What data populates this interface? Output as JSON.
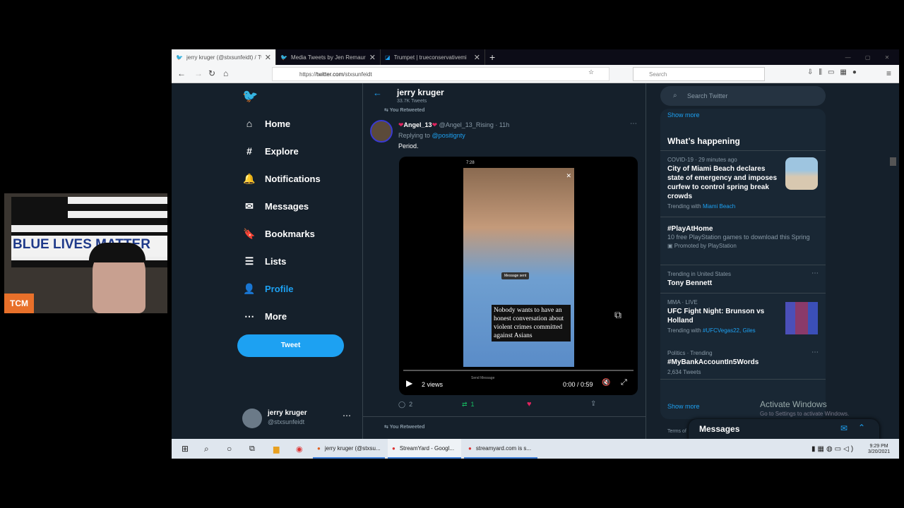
{
  "browser": {
    "tabs": [
      {
        "title": "jerry kruger (@stxsunfeidt) / Tw",
        "active": true
      },
      {
        "title": "Media Tweets by Jen Remauro",
        "active": false
      },
      {
        "title": "Trumpet | trueconservativemi",
        "active": false
      }
    ],
    "url_prefix": "https://",
    "url_domain": "twitter.com",
    "url_path": "/stxsunfeidt",
    "search_placeholder": "Search"
  },
  "nav": {
    "items": [
      {
        "label": "Home",
        "icon": "⌂"
      },
      {
        "label": "Explore",
        "icon": "#"
      },
      {
        "label": "Notifications",
        "icon": "🔔"
      },
      {
        "label": "Messages",
        "icon": "✉"
      },
      {
        "label": "Bookmarks",
        "icon": "🔖"
      },
      {
        "label": "Lists",
        "icon": "☰"
      },
      {
        "label": "Profile",
        "icon": "👤",
        "active": true
      },
      {
        "label": "More",
        "icon": "⋯"
      }
    ],
    "tweet_button": "Tweet",
    "user_name": "jerry kruger",
    "user_handle": "@stxsunfeidt"
  },
  "header": {
    "title": "jerry kruger",
    "tweet_count": "33.7K Tweets"
  },
  "tweet": {
    "retweeted_label": "You Retweeted",
    "name": "Angel_13",
    "handle": "@Angel_13_Rising",
    "time": "11h",
    "replying_prefix": "Replying to",
    "replying_to": "@positignty",
    "text": "Period.",
    "video": {
      "clock": "7:28",
      "overlay_text": "Nobody wants to have an honest conversation about violent crimes committed against Asians",
      "message_sent": "Message sent",
      "send_message": "Send Message",
      "views": "2 views",
      "time": "0:00 / 0:59"
    },
    "replies": "2",
    "retweets": "1"
  },
  "next_retweet_label": "You Retweeted",
  "right": {
    "search_placeholder": "Search Twitter",
    "show_more_top": "Show more",
    "section_title": "What’s happening",
    "trends": [
      {
        "cat": "COVID-19 · 29 minutes ago",
        "title": "City of Miami Beach declares state of emergency and imposes curfew to control spring break crowds",
        "sub_prefix": "Trending with",
        "sub_link": "Miami Beach"
      },
      {
        "cat": "",
        "title": "#PlayAtHome",
        "desc": "10 free PlayStation games to download this Spring",
        "sub_prefix": "Promoted by PlayStation"
      },
      {
        "cat": "Trending in United States",
        "title": "Tony Bennett"
      },
      {
        "cat": "MMA · LIVE",
        "title": "UFC Fight Night: Brunson vs Holland",
        "sub_prefix": "Trending with",
        "sub_link": "#UFCVegas22, Giles"
      },
      {
        "cat": "Politics · Trending",
        "title": "#MyBankAccountIn5Words",
        "sub_prefix": "2,634 Tweets"
      }
    ],
    "show_more": "Show more",
    "terms": "Terms of",
    "messages": "Messages"
  },
  "watermark": {
    "title": "Activate Windows",
    "sub": "Go to Settings to activate Windows."
  },
  "taskbar": {
    "apps": [
      "jerry kruger (@stxsu...",
      "StreamYard - Googl...",
      "streamyard.com is s..."
    ],
    "time": "9:29 PM",
    "date": "3/20/2021"
  },
  "webcam": {
    "badge": "TCM",
    "flag_text": "BLUE LIVES MATTER"
  },
  "colors": {
    "accent": "#1da1f2",
    "bg": "#15202b",
    "retweet": "#17bf63",
    "like": "#e0245e",
    "badge": "#e8702a"
  }
}
